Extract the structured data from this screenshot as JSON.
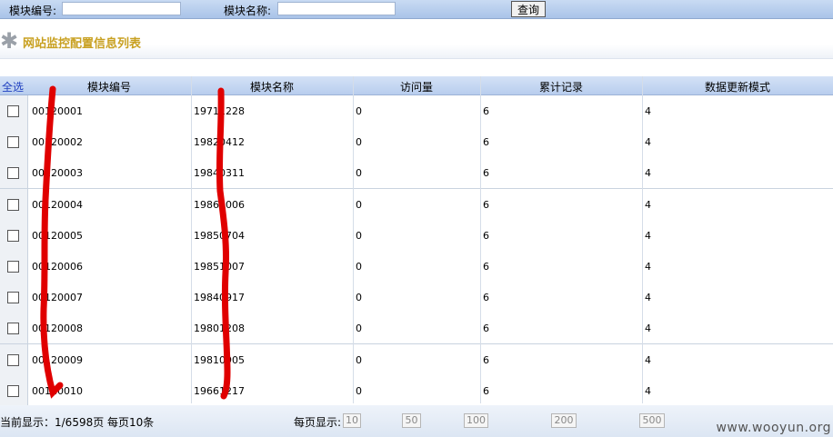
{
  "search": {
    "module_id_label": "模块编号:",
    "module_name_label": "模块名称:",
    "module_id_value": "",
    "module_name_value": "",
    "query_button": "查询"
  },
  "page": {
    "title": "网站监控配置信息列表"
  },
  "table": {
    "select_all": "全选",
    "columns": [
      "模块编号",
      "模块名称",
      "访问量",
      "累计记录",
      "数据更新模式"
    ],
    "rows": [
      [
        "00120001",
        "19711228",
        "0",
        "6",
        "4"
      ],
      [
        "00120002",
        "19820412",
        "0",
        "6",
        "4"
      ],
      [
        "00120003",
        "19840311",
        "0",
        "6",
        "4"
      ],
      [
        "00120004",
        "19861006",
        "0",
        "6",
        "4"
      ],
      [
        "00120005",
        "19850704",
        "0",
        "6",
        "4"
      ],
      [
        "00120006",
        "19851007",
        "0",
        "6",
        "4"
      ],
      [
        "00120007",
        "19840917",
        "0",
        "6",
        "4"
      ],
      [
        "00120008",
        "19801208",
        "0",
        "6",
        "4"
      ],
      [
        "00120009",
        "19810905",
        "0",
        "6",
        "4"
      ],
      [
        "00120010",
        "19661217",
        "0",
        "6",
        "4"
      ]
    ]
  },
  "footer": {
    "current_display": "当前显示：1/6598页 每页10条",
    "per_page_label": "每页显示:",
    "per_page_options": [
      "10",
      "50",
      "100",
      "200",
      "500"
    ]
  },
  "watermark": "www.wooyun.org",
  "colors": {
    "title": "#c8a020",
    "header_bg": "#b8cdee",
    "scribble": "#e00000"
  }
}
